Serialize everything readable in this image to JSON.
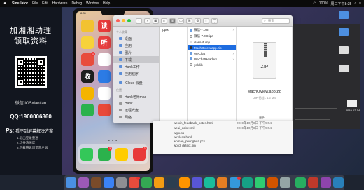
{
  "menubar": {
    "apple": "",
    "items": [
      "Simulator",
      "File",
      "Edit",
      "Hardware",
      "Debug",
      "Window",
      "Help"
    ],
    "clock": "周二下午8:35",
    "battery": "100%"
  },
  "promo": {
    "title_line1": "加湘湘助理",
    "title_line2": "领取资料",
    "wechat": "微信:iOSxiaotian",
    "qq": "QQ:1900006360",
    "ps_label": "Ps:",
    "ps_text": "看不到屏幕解决方案",
    "tips": [
      "1.退出登录重进",
      "2.切换清晰度",
      "3.下载腾讯课堂客户端"
    ]
  },
  "phone": {
    "time": "8:35",
    "apps": [
      {
        "color": "#f2c230",
        "glyph": "",
        "badge": ""
      },
      {
        "color": "#e83a3a",
        "glyph": "读",
        "badge": ""
      },
      {
        "color": "#ffffff",
        "glyph": "",
        "badge": ""
      },
      {
        "color": "#f0f0f0",
        "glyph": "",
        "badge": ""
      },
      {
        "color": "#f7d23a",
        "glyph": "",
        "badge": ""
      },
      {
        "color": "#e84040",
        "glyph": "听",
        "badge": ""
      },
      {
        "color": "#3a8ee6",
        "glyph": "",
        "badge": ""
      },
      {
        "color": "#2fa84f",
        "glyph": "",
        "badge": ""
      },
      {
        "color": "#e84c3d",
        "glyph": "",
        "badge": "1"
      },
      {
        "color": "#ffffff",
        "glyph": "",
        "badge": ""
      },
      {
        "color": "#f2f2f2",
        "glyph": "",
        "badge": ""
      },
      {
        "color": "#e6e6e6",
        "glyph": "",
        "badge": ""
      },
      {
        "color": "#1e1e1e",
        "glyph": "收",
        "badge": ""
      },
      {
        "color": "#2c7be5",
        "glyph": "",
        "badge": ""
      },
      {
        "color": "#3aa0f0",
        "glyph": "",
        "badge": ""
      },
      {
        "color": "#ffffff",
        "glyph": "",
        "badge": ""
      },
      {
        "color": "#f4b400",
        "glyph": "",
        "badge": ""
      },
      {
        "color": "#ffffff",
        "glyph": "",
        "badge": ""
      },
      {
        "color": "#2a8de0",
        "glyph": "",
        "badge": ""
      },
      {
        "color": "#e8f0f8",
        "glyph": "",
        "badge": ""
      },
      {
        "color": "#2bb24c",
        "glyph": "",
        "badge": ""
      },
      {
        "color": "#e9493a",
        "glyph": "",
        "badge": ""
      },
      {
        "color": "#f5f5f5",
        "glyph": "",
        "badge": ""
      },
      {
        "color": "#d0d8e8",
        "glyph": "",
        "badge": ""
      }
    ],
    "page_dots": "• • •",
    "dock": [
      {
        "color": "#34c759",
        "badge": ""
      },
      {
        "color": "#2bb24c",
        "badge": "3"
      },
      {
        "color": "#ffcc00",
        "badge": ""
      },
      {
        "color": "#e83a3a",
        "badge": "2"
      }
    ]
  },
  "finder": {
    "back": "‹",
    "forward": "›",
    "search_placeholder": "搜索",
    "sidebar": {
      "favorites_label": "个人收藏",
      "favorites": [
        "桌面",
        "应用",
        "图片",
        "下载",
        "Hank工作",
        "应用程序"
      ],
      "icloud": "iCloud 云盘",
      "locations_label": "位置",
      "devices": [
        "Hank老师mac",
        "Hank"
      ],
      "extra": [
        "远程光盘",
        "网络"
      ]
    },
    "col1": [
      ".pptx"
    ],
    "col2": [
      {
        "name": "微信-7.0.8",
        "folder": true
      },
      {
        "name": "微信-7.0.8.ipa",
        "folder": false
      },
      {
        "name": "class-dump",
        "folder": false
      },
      {
        "name": "MachOView.app.zip",
        "folder": false,
        "selected": true
      },
      {
        "name": "WeChat",
        "folder": true
      },
      {
        "name": "WeChatHeaders",
        "folder": true
      },
      {
        "name": "yololib",
        "folder": false
      }
    ],
    "preview": {
      "icon_label": "ZIP",
      "name": "MachOView.app.zip",
      "meta": "ZIP 归档 - 1.6 MB",
      "more": "更多..."
    }
  },
  "behind_list": [
    {
      "name": "weixin_feedback_notes.html",
      "date": "2019年10月8日 下午5:54"
    },
    {
      "name": "weui_color.xml",
      "date": "2019年10月8日 下午5:54"
    },
    {
      "name": "wgfx.so",
      "date": ""
    },
    {
      "name": "wireless.html",
      "date": ""
    },
    {
      "name": "woman_pucnghua.pcx",
      "date": ""
    },
    {
      "name": "word_detect.bin",
      "date": ""
    }
  ],
  "desktop_icons": [
    "",
    "",
    "",
    "",
    "2019-12-14"
  ],
  "colors": {
    "finder_selection": "#1d6ce0",
    "folder_blue": "#5c8ed8"
  }
}
